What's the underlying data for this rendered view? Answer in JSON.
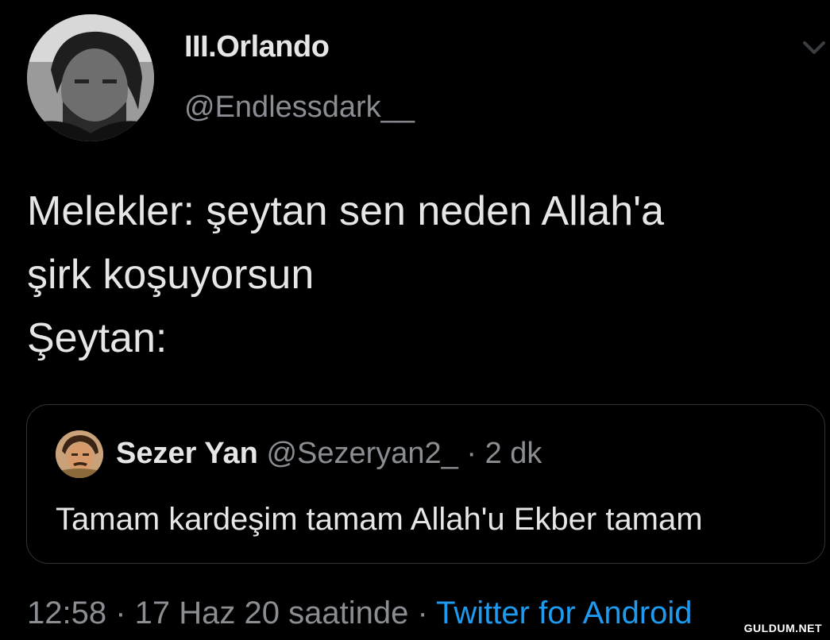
{
  "author": {
    "display_name": "III.Orlando",
    "handle": "@Endlessdark__"
  },
  "tweet": {
    "lines": [
      "Melekler: şeytan sen neden Allah'a",
      "şirk koşuyorsun",
      "Şeytan:"
    ]
  },
  "quoted_tweet": {
    "display_name": "Sezer Yan",
    "handle": "@Sezeryan2_",
    "separator": " · ",
    "time_ago": "2 dk",
    "text": "Tamam kardeşim tamam Allah'u Ekber tamam"
  },
  "meta": {
    "timestamp": "12:58 · 17 Haz 20 saatinde",
    "separator": " · ",
    "source": "Twitter for Android"
  },
  "watermark": "GULDUM.NET",
  "icons": {
    "menu": "chevron-down-icon"
  },
  "colors": {
    "background": "#000000",
    "primary_text": "#e6e6e6",
    "secondary_text": "#8a8d91",
    "link": "#1d9bf0",
    "border": "#2f3336"
  }
}
